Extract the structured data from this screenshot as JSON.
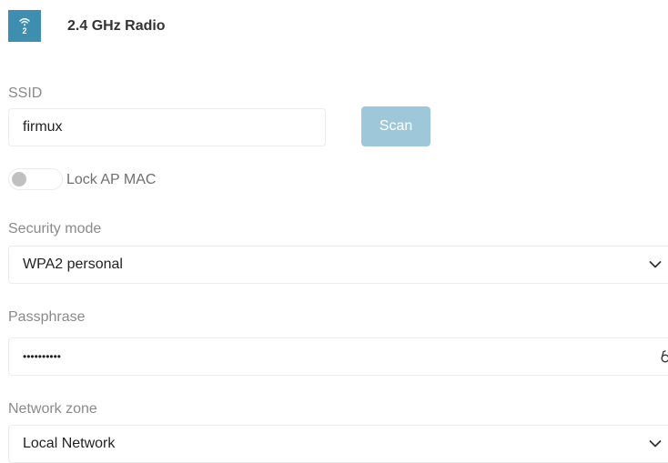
{
  "header": {
    "badge_number": "2",
    "title": "2.4 GHz Radio"
  },
  "ssid": {
    "label": "SSID",
    "value": "firmux",
    "scan_label": "Scan"
  },
  "lock_ap_mac": {
    "label": "Lock AP MAC",
    "enabled": false
  },
  "security_mode": {
    "label": "Security mode",
    "value": "WPA2 personal"
  },
  "passphrase": {
    "label": "Passphrase",
    "value": "••••••••••"
  },
  "network_zone": {
    "label": "Network zone",
    "value": "Local Network"
  },
  "icons": [
    "wifi-icon",
    "chevron-down-icon",
    "glasses-icon"
  ],
  "colors": {
    "accent": "#3e8eb0",
    "button": "#9ec8d9"
  }
}
